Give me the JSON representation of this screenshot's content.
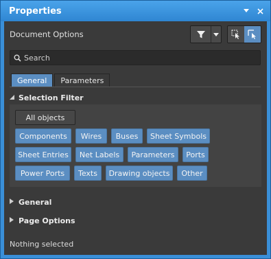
{
  "window": {
    "title": "Properties",
    "pin_icon": "pin-dropdown-icon",
    "close_icon": "close-icon"
  },
  "toolbar": {
    "document_label": "Document Options",
    "filter_icon": "funnel-icon",
    "dropdown_icon": "chevron-down-icon",
    "select_icon_1": "select-arrow-icon",
    "select_icon_2": "select-arrow-active-icon"
  },
  "search": {
    "placeholder": "Search",
    "value": ""
  },
  "tabs": [
    {
      "label": "General",
      "active": true
    },
    {
      "label": "Parameters",
      "active": false
    }
  ],
  "selection_filter": {
    "heading": "Selection Filter",
    "expanded": true,
    "all_objects": "All objects",
    "chips": [
      "Components",
      "Wires",
      "Buses",
      "Sheet Symbols",
      "Sheet Entries",
      "Net Labels",
      "Parameters",
      "Ports",
      "Power Ports",
      "Texts",
      "Drawing objects",
      "Other"
    ]
  },
  "sections": [
    {
      "label": "General",
      "expanded": false
    },
    {
      "label": "Page Options",
      "expanded": false
    }
  ],
  "status": {
    "text": "Nothing selected"
  },
  "colors": {
    "frame": "#3a8fd8",
    "panel": "#3a3a3a",
    "accent": "#5b8ec2"
  }
}
